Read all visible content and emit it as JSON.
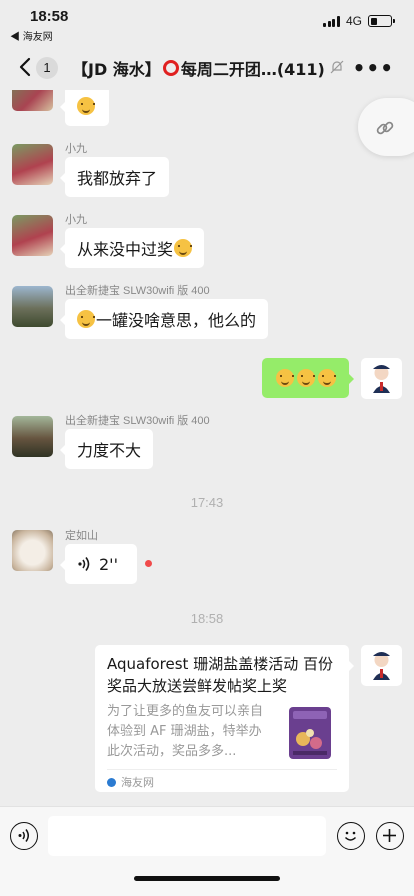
{
  "status": {
    "time": "18:58",
    "back_app": "◀ 海友网",
    "network": "4G",
    "battery_level": 0.35
  },
  "nav": {
    "back_count": "1",
    "title_prefix": "【JD 海水】",
    "title_suffix": "每周二开团…(411)"
  },
  "messages": [
    {
      "sender": "小九",
      "text": "我都放弃了"
    },
    {
      "sender": "小九",
      "text": "从来没中过奖"
    },
    {
      "sender": "出全新捷宝 SLW30wifi 版 400",
      "text": "一罐没啥意思，他么的"
    },
    {
      "sender": "出全新捷宝 SLW30wifi 版 400",
      "text": "力度不大"
    },
    {
      "sender": "定如山",
      "text": "2''"
    }
  ],
  "timestamps": [
    "17:43",
    "18:58"
  ],
  "card": {
    "title": "Aquaforest 珊湖盐盖楼活动 百份奖品大放送尝鲜发帖奖上奖",
    "description": "为了让更多的鱼友可以亲自体验到 AF 珊湖盐，特举办此次活动，奖品多多...",
    "source": "海友网"
  },
  "colors": {
    "background": "#ededed",
    "self_bubble": "#95ec69",
    "unread_dot": "#f04a4a",
    "mute_ring": "#e02020"
  }
}
